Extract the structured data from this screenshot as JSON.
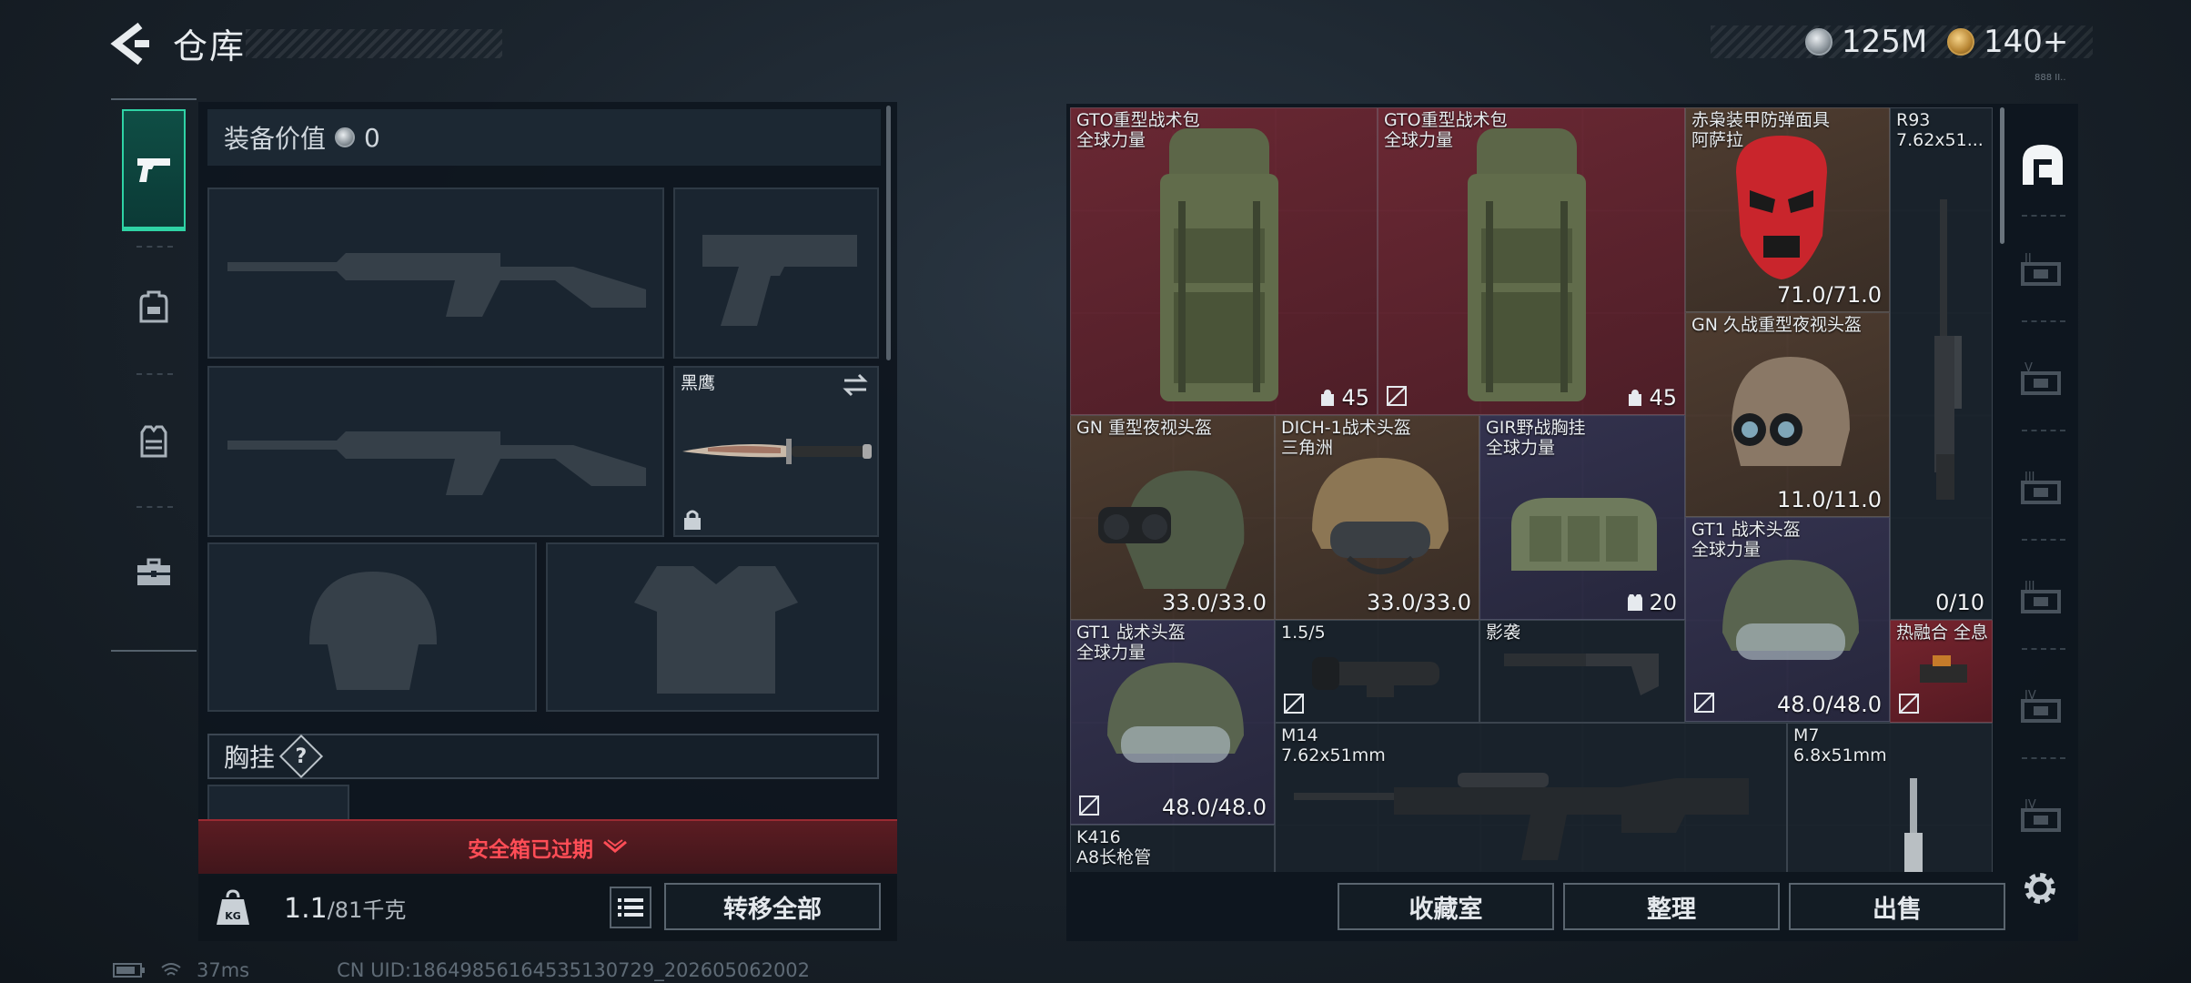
{
  "header": {
    "title": "仓库",
    "currency_silver": "125M",
    "currency_gold": "140+",
    "tiny_label": "888 II.."
  },
  "left_tabs": [
    {
      "icon": "pistol-icon",
      "active": true
    },
    {
      "icon": "backpack-icon",
      "active": false
    },
    {
      "icon": "vest-icon",
      "active": false
    },
    {
      "icon": "toolbox-icon",
      "active": false
    }
  ],
  "equipment": {
    "value_label": "装备价值",
    "value": "0",
    "melee_name": "黑鹰",
    "chest_label": "胸挂",
    "help_glyph": "?",
    "safe_box_banner": "安全箱已过期",
    "weight_value": "1.1",
    "weight_capacity": "/81千克",
    "transfer_all_label": "转移全部"
  },
  "inventory": {
    "items": [
      {
        "name": "GTO重型战术包",
        "sub": "全球力量",
        "value": "45",
        "value_icon": "capacity-icon",
        "rarity": "red",
        "mark": false
      },
      {
        "name": "GTO重型战术包",
        "sub": "全球力量",
        "value": "45",
        "value_icon": "capacity-icon",
        "rarity": "red",
        "mark": true
      },
      {
        "name": "赤枭装甲防弹面具",
        "sub": "阿萨拉",
        "value": "71.0/71.0",
        "rarity": "brown"
      },
      {
        "name": "R93",
        "sub": "7.62x51...",
        "value": "0/10",
        "rarity": "dark"
      },
      {
        "name": "GN 久战重型夜视头盔",
        "sub": "",
        "value": "11.0/11.0",
        "rarity": "brown"
      },
      {
        "name": "GN 重型夜视头盔",
        "sub": "",
        "value": "33.0/33.0",
        "rarity": "brown"
      },
      {
        "name": "DICH-1战术头盔",
        "sub": "三角洲",
        "value": "33.0/33.0",
        "rarity": "brown"
      },
      {
        "name": "GIR野战胸挂",
        "sub": "全球力量",
        "value": "20",
        "value_icon": "vest-small-icon",
        "rarity": "purple"
      },
      {
        "name": "GT1 战术头盔",
        "sub": "全球力量",
        "value": "48.0/48.0",
        "rarity": "purple",
        "mark": true
      },
      {
        "name": "GT1 战术头盔",
        "sub": "全球力量",
        "value": "48.0/48.0",
        "rarity": "purple",
        "mark": true
      },
      {
        "name": "1.5/5",
        "sub": "",
        "value": "",
        "rarity": "dark",
        "mark": true
      },
      {
        "name": "影袭",
        "sub": "",
        "value": "",
        "rarity": "dark"
      },
      {
        "name": "热融合 全息",
        "sub": "",
        "value": "",
        "rarity": "redsmall",
        "mark": true
      },
      {
        "name": "M14",
        "sub": "7.62x51mm",
        "value": "",
        "rarity": "dark"
      },
      {
        "name": "M7",
        "sub": "6.8x51mm",
        "value": "",
        "rarity": "dark"
      },
      {
        "name": "K416",
        "sub": "A8长枪管",
        "value": "",
        "rarity": "dark"
      }
    ],
    "buttons": {
      "collection": "收藏室",
      "organize": "整理",
      "sell": "出售"
    }
  },
  "right_tabs": [
    {
      "icon": "storage-home-icon",
      "label": "",
      "active": true
    },
    {
      "icon": "warehouse-tab-icon",
      "label": "II",
      "active": false
    },
    {
      "icon": "warehouse-tab-icon",
      "label": "V",
      "active": false
    },
    {
      "icon": "warehouse-tab-icon",
      "label": "III",
      "active": false
    },
    {
      "icon": "warehouse-tab-icon",
      "label": "III",
      "active": false
    },
    {
      "icon": "warehouse-tab-icon",
      "label": "IV",
      "active": false
    },
    {
      "icon": "warehouse-tab-icon",
      "label": "IV",
      "active": false
    }
  ],
  "status": {
    "ping": "37ms",
    "uid": "CN UID:186498561645351307​29_202605062002"
  }
}
